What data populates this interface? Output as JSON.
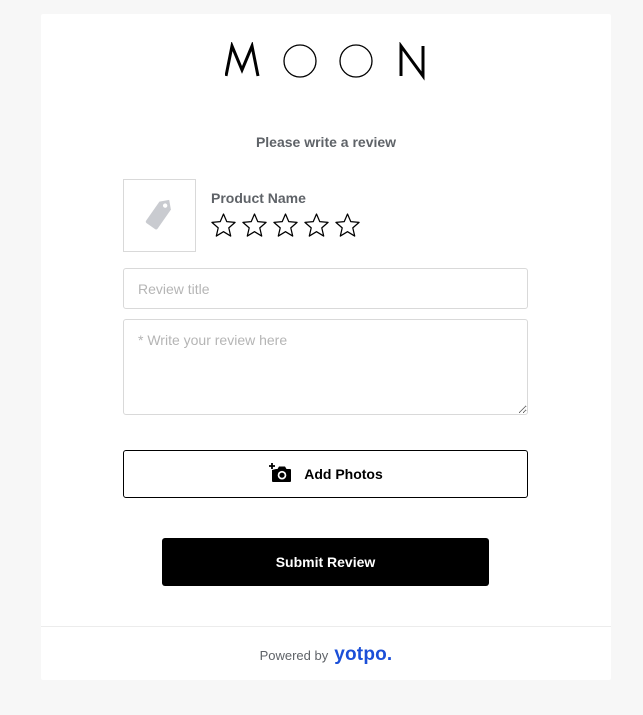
{
  "brand": {
    "logo_text": "MOON"
  },
  "form": {
    "heading": "Please write a review",
    "product_name": "Product Name",
    "rating": {
      "max": 5,
      "selected": 0
    },
    "title_placeholder": "Review title",
    "body_placeholder": "* Write your review here",
    "add_photos_label": "Add Photos",
    "submit_label": "Submit Review"
  },
  "footer": {
    "powered_by": "Powered by",
    "provider": "yotpo."
  },
  "colors": {
    "accent_link": "#1b4fd8",
    "submit_bg": "#000000",
    "muted_text": "#5f6368"
  },
  "icons": {
    "product": "tag-icon",
    "star": "star-outline-icon",
    "add_photo": "camera-plus-icon"
  }
}
